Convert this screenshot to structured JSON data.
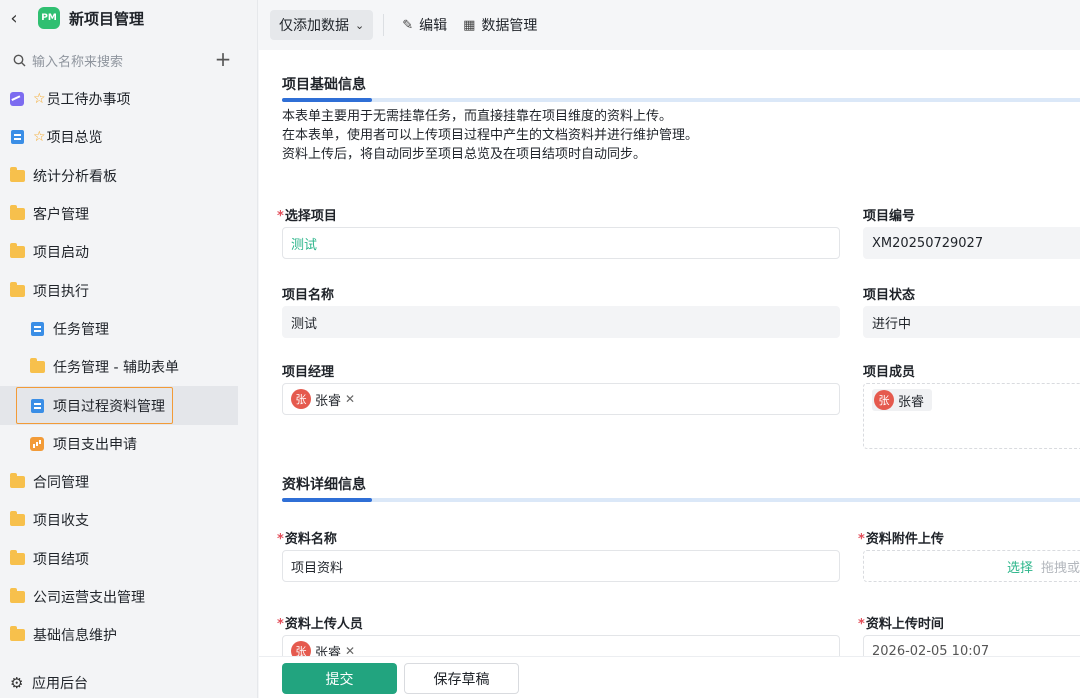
{
  "app": {
    "title": "新项目管理",
    "logo_text": "PM"
  },
  "search": {
    "placeholder": "输入名称来搜索"
  },
  "nav": [
    {
      "label": "员工待办事项",
      "icon": "chart-icon",
      "star": true
    },
    {
      "label": "项目总览",
      "icon": "form-icon",
      "star": true
    },
    {
      "label": "统计分析看板",
      "icon": "folder-icon"
    },
    {
      "label": "客户管理",
      "icon": "folder-icon"
    },
    {
      "label": "项目启动",
      "icon": "folder-icon"
    },
    {
      "label": "项目执行",
      "icon": "folder-open-icon"
    },
    {
      "label": "任务管理",
      "icon": "form-icon",
      "child": true
    },
    {
      "label": "任务管理 - 辅助表单",
      "icon": "folder-icon",
      "child": true
    },
    {
      "label": "项目过程资料管理",
      "icon": "form-icon",
      "child": true,
      "active": true
    },
    {
      "label": "项目支出申请",
      "icon": "bars-icon",
      "child": true
    },
    {
      "label": "合同管理",
      "icon": "folder-icon"
    },
    {
      "label": "项目收支",
      "icon": "folder-icon"
    },
    {
      "label": "项目结项",
      "icon": "folder-icon"
    },
    {
      "label": "公司运营支出管理",
      "icon": "folder-icon"
    },
    {
      "label": "基础信息维护",
      "icon": "folder-icon"
    }
  ],
  "footer_nav": {
    "label": "应用后台"
  },
  "toolbar": {
    "mode_label": "仅添加数据",
    "edit_label": "编辑",
    "data_label": "数据管理"
  },
  "section1": {
    "title": "项目基础信息",
    "desc": [
      "本表单主要用于无需挂靠任务，而直接挂靠在项目维度的资料上传。",
      "在本表单，使用者可以上传项目过程中产生的文档资料并进行维护管理。",
      "资料上传后，将自动同步至项目总览及在项目结项时自动同步。"
    ]
  },
  "fields": {
    "select_project": {
      "label": "选择项目",
      "value": "测试"
    },
    "project_no": {
      "label": "项目编号",
      "value": "XM20250729027"
    },
    "project_name": {
      "label": "项目名称",
      "value": "测试"
    },
    "project_status": {
      "label": "项目状态",
      "value": "进行中"
    },
    "project_manager": {
      "label": "项目经理",
      "user": "张睿",
      "avatar": "张"
    },
    "project_members": {
      "label": "项目成员",
      "user": "张睿",
      "avatar": "张"
    }
  },
  "section2": {
    "title": "资料详细信息"
  },
  "fields2": {
    "doc_name": {
      "label": "资料名称",
      "value": "项目资料"
    },
    "doc_upload": {
      "label": "资料附件上传",
      "select": "选择",
      "hint": "拖拽或"
    },
    "uploader": {
      "label": "资料上传人员",
      "user": "张睿",
      "avatar": "张"
    },
    "upload_time": {
      "label": "资料上传时间",
      "value": "2026-02-05 10:07"
    }
  },
  "actions": {
    "submit": "提交",
    "save_draft": "保存草稿"
  }
}
